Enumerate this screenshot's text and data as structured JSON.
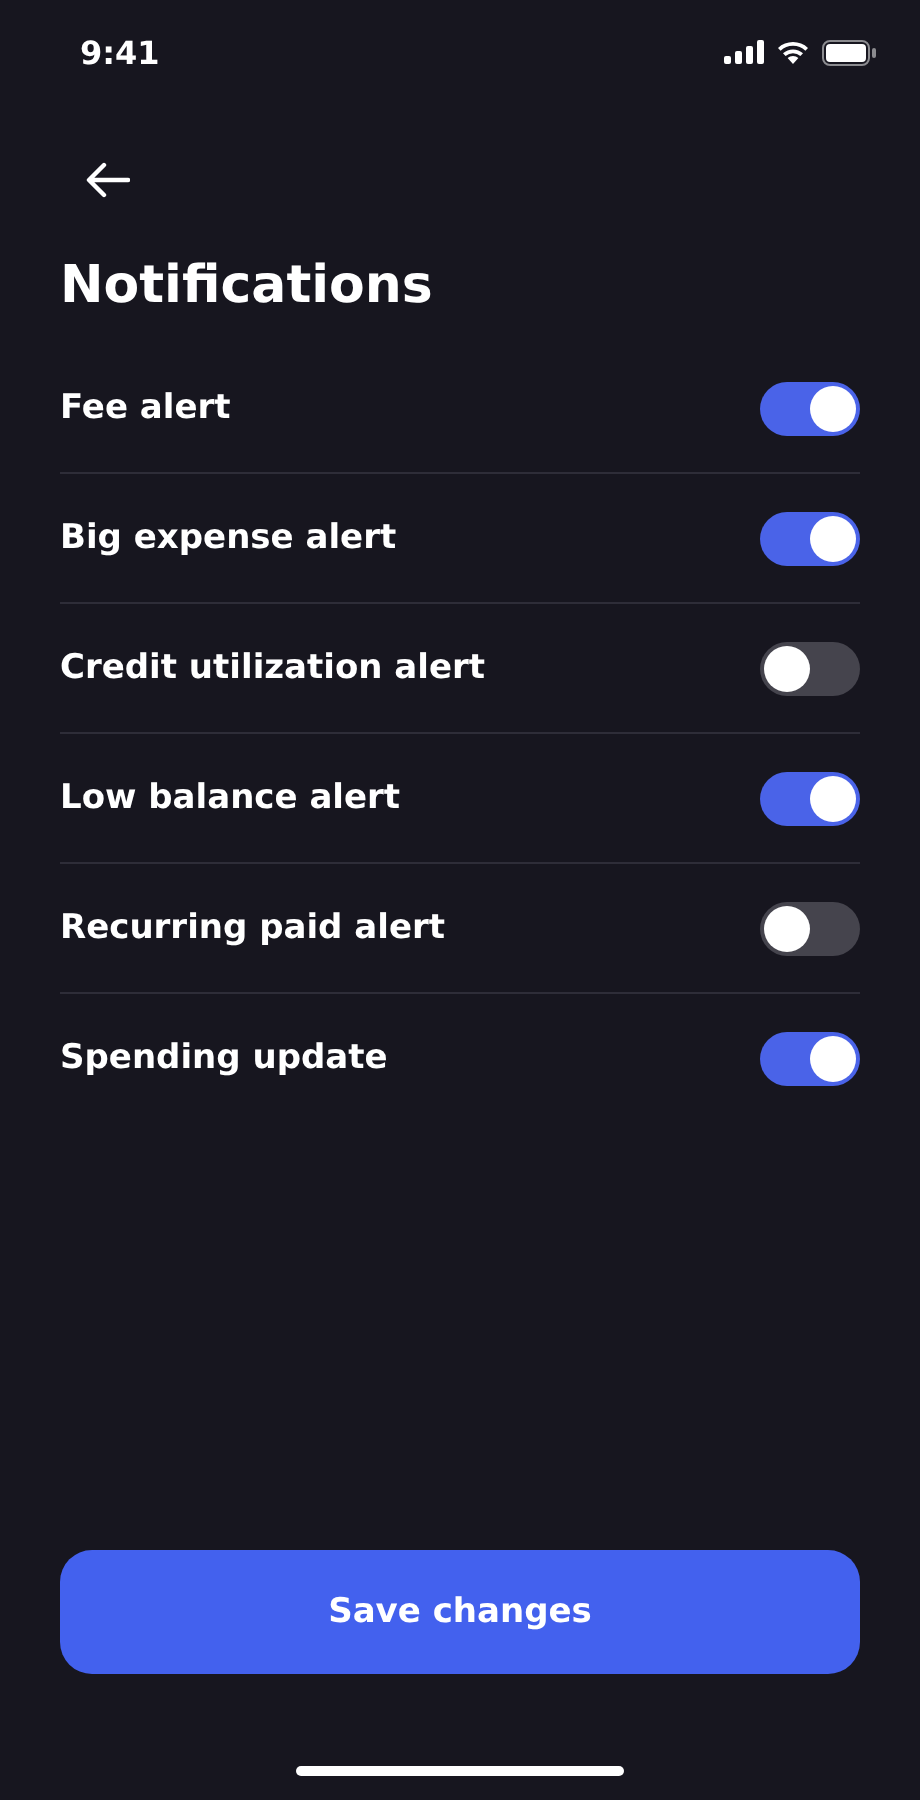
{
  "status_bar": {
    "time": "9:41"
  },
  "title": "Notifications",
  "settings": [
    {
      "label": "Fee alert",
      "on": true
    },
    {
      "label": "Big expense alert",
      "on": true
    },
    {
      "label": "Credit utilization alert",
      "on": false
    },
    {
      "label": "Low balance alert",
      "on": true
    },
    {
      "label": "Recurring paid alert",
      "on": false
    },
    {
      "label": "Spending update",
      "on": true
    }
  ],
  "save_button": "Save changes"
}
